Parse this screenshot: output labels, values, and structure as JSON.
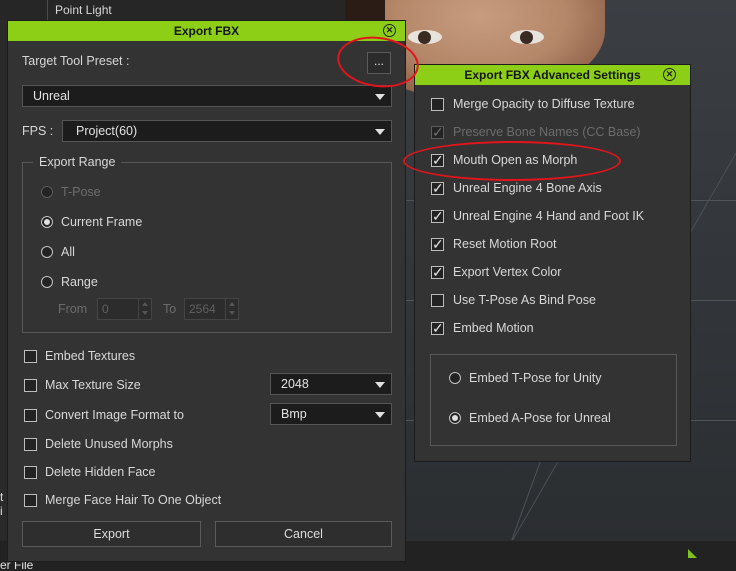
{
  "background": {
    "tree_item": "Point Light",
    "bottom_label": "er File",
    "left_strip_label": "t i"
  },
  "export_fbx": {
    "title": "Export FBX",
    "target_tool_preset_label": "Target Tool Preset :",
    "preset_button_label": "...",
    "preset_value": "Unreal",
    "fps_label": "FPS :",
    "fps_value": "Project(60)",
    "export_range": {
      "title": "Export Range",
      "options": [
        {
          "label": "T-Pose",
          "selected": false,
          "enabled": false
        },
        {
          "label": "Current Frame",
          "selected": true,
          "enabled": true
        },
        {
          "label": "All",
          "selected": false,
          "enabled": true
        },
        {
          "label": "Range",
          "selected": false,
          "enabled": true
        }
      ],
      "from_label": "From",
      "from_value": "0",
      "to_label": "To",
      "to_value": "2564"
    },
    "options": [
      {
        "label": "Embed Textures",
        "checked": false
      },
      {
        "label": "Max Texture Size",
        "checked": false,
        "dropdown": "2048"
      },
      {
        "label": "Convert Image Format to",
        "checked": false,
        "dropdown": "Bmp"
      },
      {
        "label": "Delete Unused Morphs",
        "checked": false
      },
      {
        "label": "Delete Hidden Face",
        "checked": false
      },
      {
        "label": "Merge Face Hair To One Object",
        "checked": false
      }
    ],
    "export_button": "Export",
    "cancel_button": "Cancel"
  },
  "advanced": {
    "title": "Export FBX Advanced Settings",
    "options": [
      {
        "label": "Merge Opacity to Diffuse Texture",
        "checked": false,
        "enabled": true
      },
      {
        "label": "Preserve Bone Names (CC Base)",
        "checked": true,
        "enabled": false
      },
      {
        "label": "Mouth Open as Morph",
        "checked": true,
        "enabled": true
      },
      {
        "label": "Unreal Engine 4 Bone Axis",
        "checked": true,
        "enabled": true
      },
      {
        "label": "Unreal Engine 4 Hand and Foot IK",
        "checked": true,
        "enabled": true
      },
      {
        "label": "Reset Motion Root",
        "checked": true,
        "enabled": true
      },
      {
        "label": "Export Vertex Color",
        "checked": true,
        "enabled": true
      },
      {
        "label": "Use T-Pose As Bind Pose",
        "checked": false,
        "enabled": true
      },
      {
        "label": "Embed Motion",
        "checked": true,
        "enabled": true
      }
    ],
    "pose_options": [
      {
        "label": "Embed T-Pose for Unity",
        "selected": false
      },
      {
        "label": "Embed A-Pose for Unreal",
        "selected": true
      }
    ]
  },
  "colors": {
    "title_bar": "#8ccf16",
    "annotation": "#e3141b",
    "dialog_bg": "#333333"
  }
}
